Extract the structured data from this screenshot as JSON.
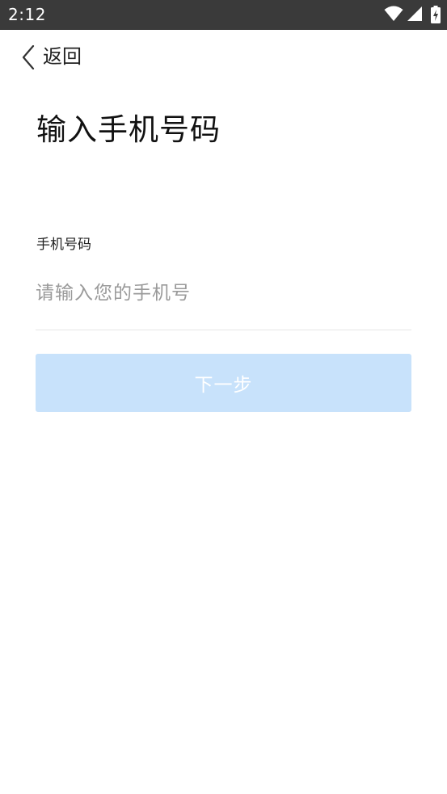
{
  "status_bar": {
    "time": "2:12",
    "icons": [
      "wifi-icon",
      "cellular-signal-icon",
      "battery-charging-icon"
    ]
  },
  "header": {
    "back_label": "返回",
    "back_icon": "chevron-left-icon"
  },
  "page": {
    "title": "输入手机号码"
  },
  "form": {
    "phone_label": "手机号码",
    "phone_value": "",
    "phone_placeholder": "请输入您的手机号",
    "next_label": "下一步"
  },
  "colors": {
    "status_bar_bg": "#3a3a3a",
    "button_disabled_bg": "#c8e2fb",
    "placeholder": "#9a9a9a",
    "divider": "#e6e6e6"
  }
}
